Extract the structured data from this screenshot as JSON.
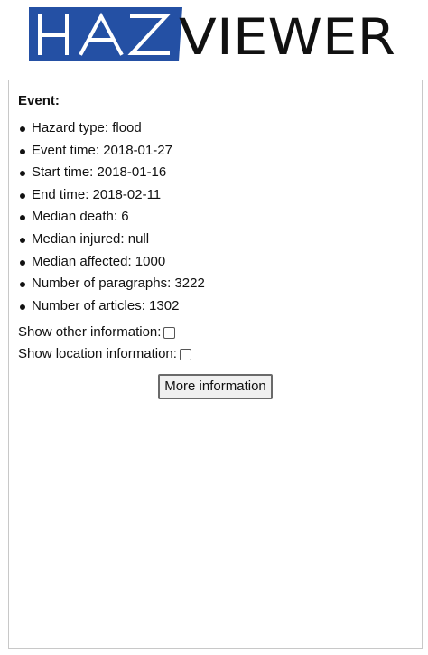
{
  "logo": {
    "brand_left": "HAZ",
    "brand_right": "VIEWER",
    "accent_color": "#2450a4"
  },
  "panel": {
    "title": "Event:",
    "fields": [
      {
        "label": "Hazard type",
        "value": "flood",
        "text": "Hazard type: flood"
      },
      {
        "label": "Event time",
        "value": "2018-01-27",
        "text": "Event time: 2018-01-27"
      },
      {
        "label": "Start time",
        "value": "2018-01-16",
        "text": "Start time: 2018-01-16"
      },
      {
        "label": "End time",
        "value": "2018-02-11",
        "text": "End time: 2018-02-11"
      },
      {
        "label": "Median death",
        "value": "6",
        "text": "Median death: 6"
      },
      {
        "label": "Median injured",
        "value": "null",
        "text": "Median injured: null"
      },
      {
        "label": "Median affected",
        "value": "1000",
        "text": "Median affected: 1000"
      },
      {
        "label": "Number of paragraphs",
        "value": "3222",
        "text": "Number of paragraphs: 3222"
      },
      {
        "label": "Number of articles",
        "value": "1302",
        "text": "Number of articles: 1302"
      }
    ],
    "toggles": {
      "other_info_label": "Show other information:",
      "other_info_checked": false,
      "location_info_label": "Show location information:",
      "location_info_checked": false
    },
    "more_button_label": "More information"
  }
}
